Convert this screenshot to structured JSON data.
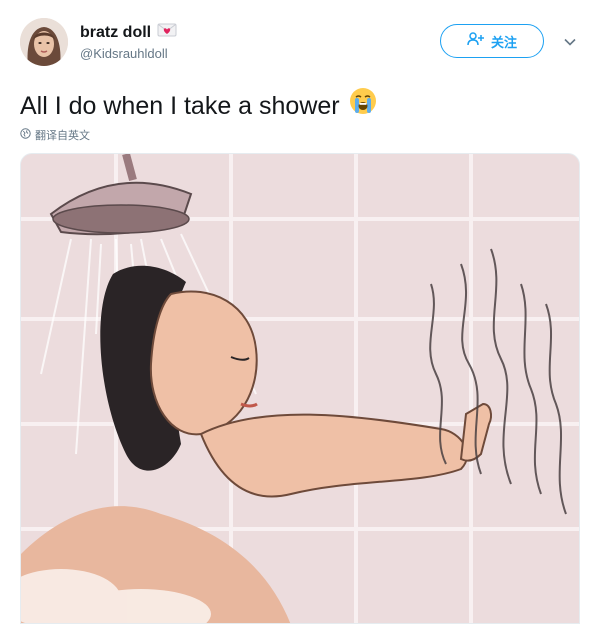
{
  "tweet": {
    "display_name": "bratz doll",
    "handle": "@Kidsrauhldoll",
    "text": "All I do when I take a shower",
    "translate_label": "翻译自英文",
    "follow_label": "关注"
  },
  "icons": {
    "name_emoji": "love-letter-icon",
    "text_emoji": "loudly-crying-face-icon",
    "globe": "globe-icon",
    "add_user": "add-user-icon",
    "caret": "chevron-down-icon"
  },
  "colors": {
    "accent": "#1da1f2",
    "text_primary": "#14171a",
    "text_secondary": "#657786"
  }
}
